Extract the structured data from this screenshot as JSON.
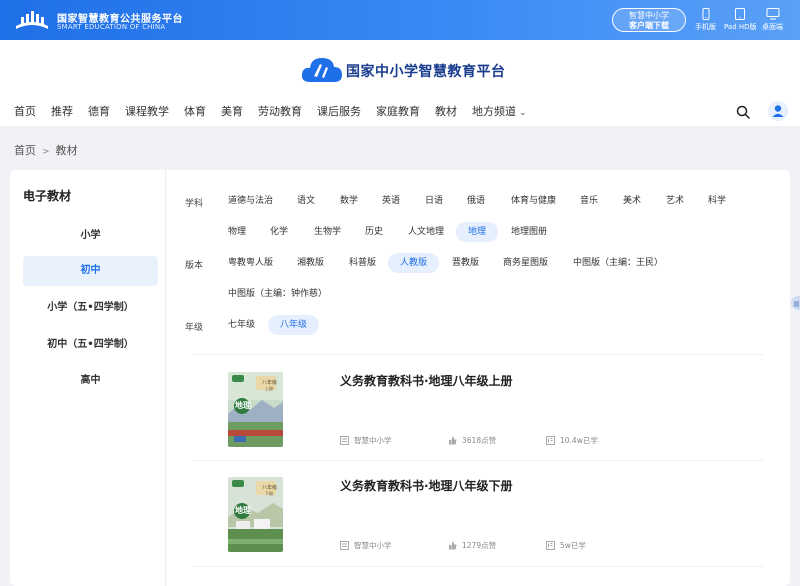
{
  "topbar": {
    "title_cn": "国家智慧教育公共服务平台",
    "title_en": "SMART EDUCATION OF CHINA",
    "download": {
      "line1": "智慧中小学",
      "line2": "客户端下载"
    },
    "devices": [
      {
        "label": "手机版",
        "icon": "phone-icon"
      },
      {
        "label": "Pad HD版",
        "icon": "tablet-icon"
      },
      {
        "label": "桌面端",
        "icon": "desktop-icon"
      }
    ]
  },
  "header": {
    "brand": "国家中小学智慧教育平台",
    "nav": [
      {
        "label": "首页"
      },
      {
        "label": "推荐"
      },
      {
        "label": "德育"
      },
      {
        "label": "课程教学"
      },
      {
        "label": "体育"
      },
      {
        "label": "美育"
      },
      {
        "label": "劳动教育"
      },
      {
        "label": "课后服务"
      },
      {
        "label": "家庭教育"
      },
      {
        "label": "教材"
      },
      {
        "label": "地方频道",
        "dropdown": true
      }
    ]
  },
  "breadcrumb": {
    "home": "首页",
    "sep": ">",
    "current": "教材"
  },
  "sidebar": {
    "title": "电子教材",
    "items": [
      {
        "label": "小学",
        "active": false
      },
      {
        "label": "初中",
        "active": true
      },
      {
        "label": "小学（五•四学制）",
        "active": false
      },
      {
        "label": "初中（五•四学制）",
        "active": false
      },
      {
        "label": "高中",
        "active": false
      }
    ]
  },
  "filters": {
    "subject": {
      "label": "学科",
      "row1": [
        "道德与法治",
        "语文",
        "数学",
        "英语",
        "日语",
        "俄语",
        "体育与健康",
        "音乐",
        "美术",
        "艺术",
        "科学"
      ],
      "row2": [
        "物理",
        "化学",
        "生物学",
        "历史",
        "人文地理",
        "地理",
        "地理图册"
      ],
      "active": "地理"
    },
    "edition": {
      "label": "版本",
      "row1": [
        "粤教粤人版",
        "湘教版",
        "科普版",
        "人教版",
        "晋教版",
        "商务星图版",
        "中图版（主编：王民）"
      ],
      "row2": [
        "中图版（主编：钟作慈）"
      ],
      "active": "人教版"
    },
    "grade": {
      "label": "年级",
      "row1": [
        "七年级",
        "八年级"
      ],
      "active": "八年级"
    }
  },
  "books": [
    {
      "title": "义务教育教科书·地理八年级上册",
      "publisher": "智慧中小学",
      "likes": "3618点赞",
      "learners": "10.4w已学",
      "cover_subject": "地理",
      "cover_grade": "八年级",
      "cover_term": "上册"
    },
    {
      "title": "义务教育教科书·地理八年级下册",
      "publisher": "智慧中小学",
      "likes": "1279点赞",
      "learners": "5w已学",
      "cover_subject": "地理",
      "cover_grade": "八年级",
      "cover_term": "下册"
    }
  ],
  "colors": {
    "accent": "#1f6fe8",
    "active_bg": "#e6effd",
    "page_bg": "#f0f2f5"
  }
}
